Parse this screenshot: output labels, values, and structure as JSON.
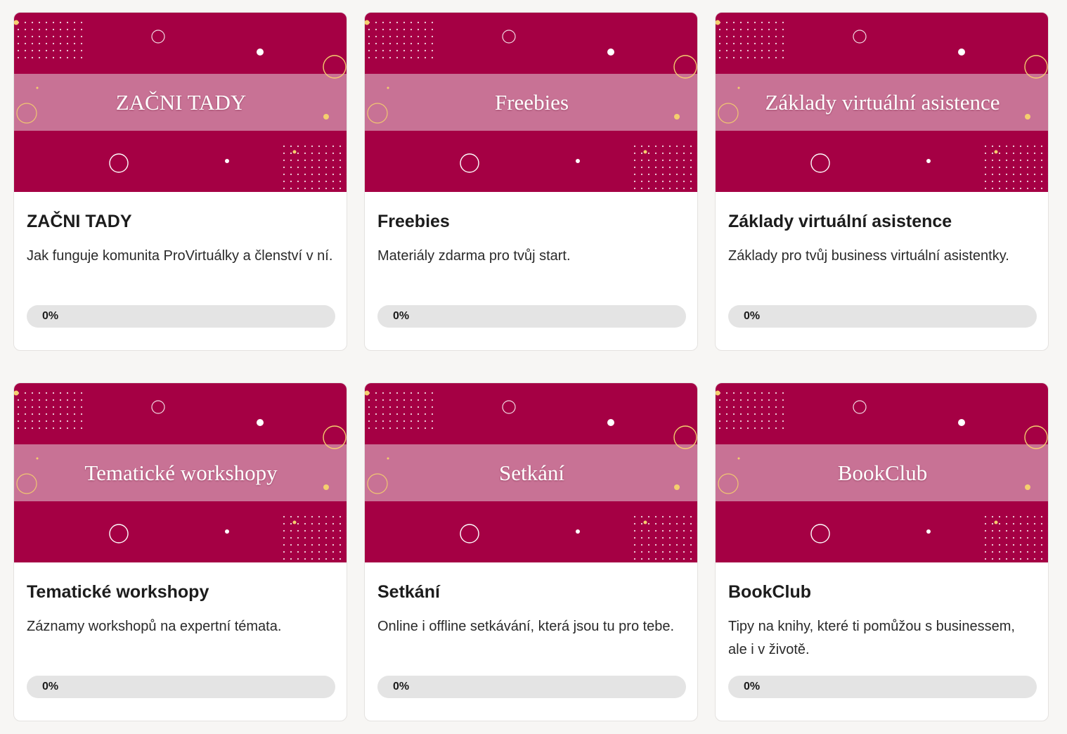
{
  "theme": {
    "banner_color": "#a50044",
    "band_color": "#c87295",
    "accent_gold": "#f4cf6e",
    "progress_fill_color": "#a50044"
  },
  "courses": [
    {
      "banner_text": "ZAČNI TADY",
      "title": "ZAČNI TADY",
      "description": "Jak funguje komunita ProVirtuálky a členství v ní.",
      "progress": 0,
      "progress_label": "0%"
    },
    {
      "banner_text": "Freebies",
      "title": "Freebies",
      "description": "Materiály zdarma pro tvůj start.",
      "progress": 0,
      "progress_label": "0%"
    },
    {
      "banner_text": "Základy virtuální asistence",
      "title": "Základy virtuální asistence",
      "description": "Základy pro tvůj business virtuální asistentky.",
      "progress": 0,
      "progress_label": "0%"
    },
    {
      "banner_text": "Tematické workshopy",
      "title": "Tematické workshopy",
      "description": "Záznamy workshopů na expertní témata.",
      "progress": 0,
      "progress_label": "0%"
    },
    {
      "banner_text": "Setkání",
      "title": "Setkání",
      "description": "Online i offline setkávání, která jsou tu pro tebe.",
      "progress": 0,
      "progress_label": "0%"
    },
    {
      "banner_text": "BookClub",
      "title": "BookClub",
      "description": "Tipy na knihy, které ti pomůžou s businessem, ale i v životě.",
      "progress": 0,
      "progress_label": "0%"
    }
  ]
}
